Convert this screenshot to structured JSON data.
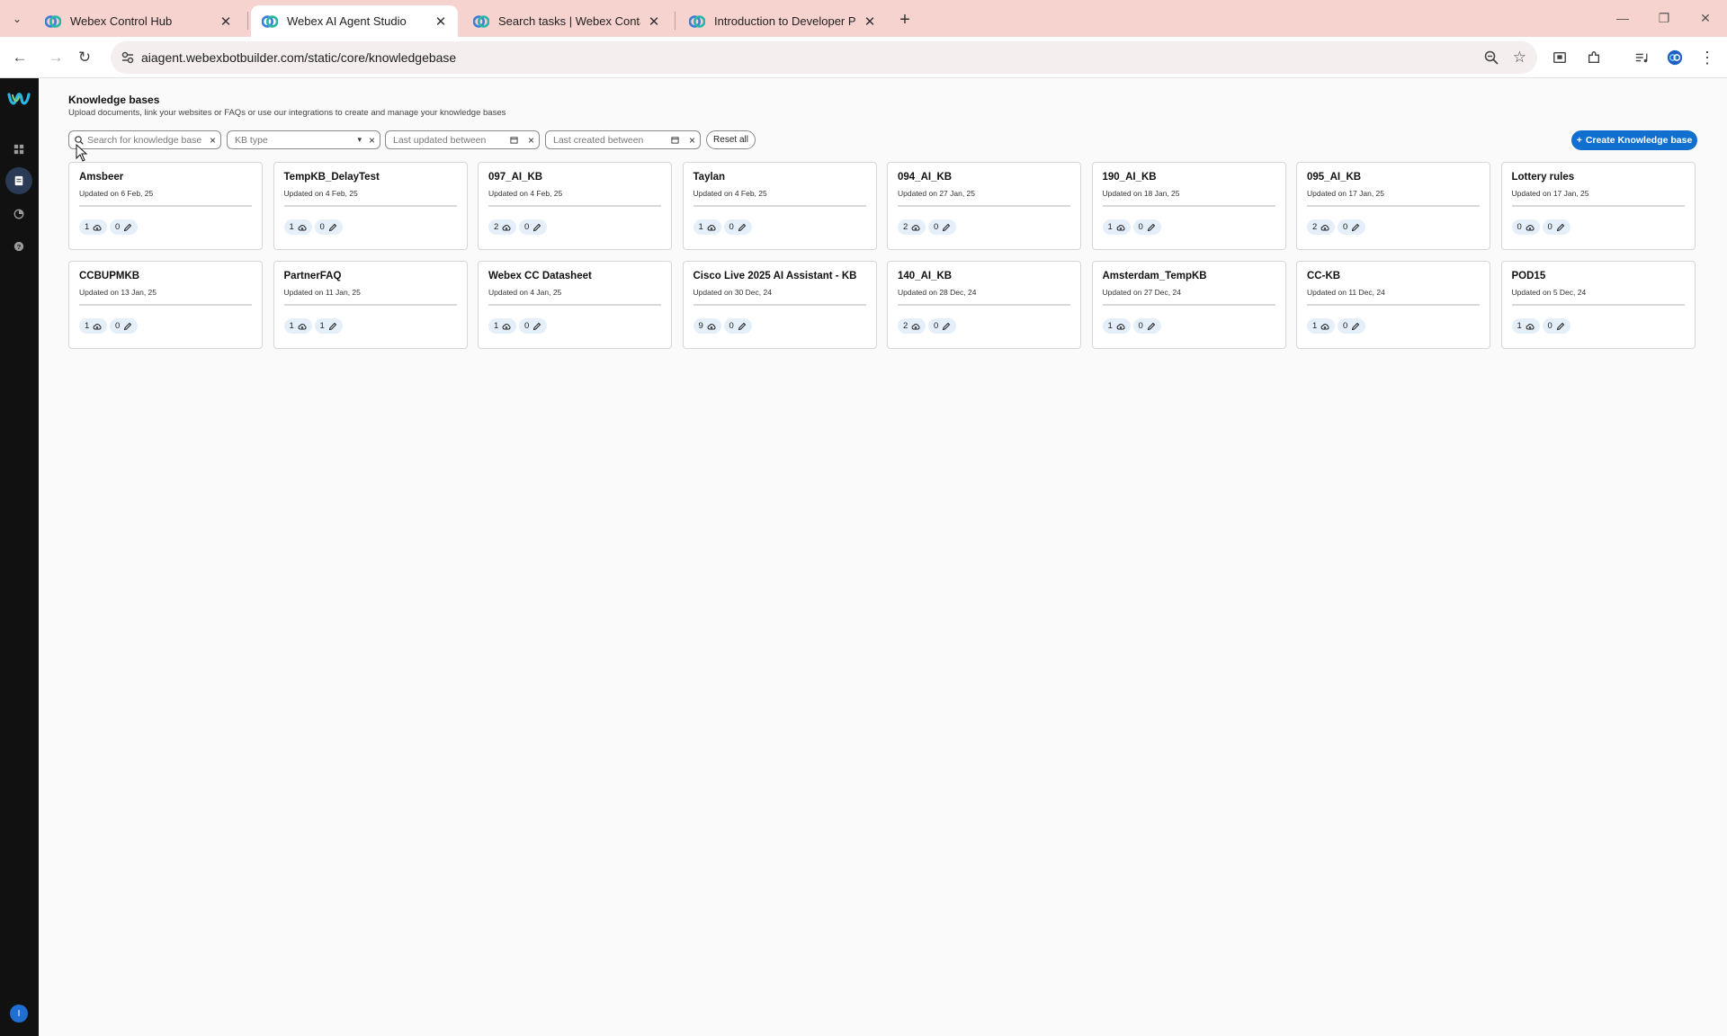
{
  "browser": {
    "tabs": [
      {
        "title": "Webex Control Hub",
        "active": false
      },
      {
        "title": "Webex AI Agent Studio",
        "active": true
      },
      {
        "title": "Search tasks | Webex Contact C",
        "active": false
      },
      {
        "title": "Introduction to Developer Porta",
        "active": false
      }
    ],
    "url": "aiagent.webexbotbuilder.com/static/core/knowledgebase"
  },
  "sidebar": {
    "items": [
      "dashboard-icon",
      "knowledge-base-icon",
      "analytics-icon",
      "help-icon"
    ],
    "active_item": "knowledge-base-icon",
    "avatar_initial": "I"
  },
  "page": {
    "title": "Knowledge bases",
    "subtitle": "Upload documents, link your websites or FAQs or use our integrations to create and manage your knowledge bases"
  },
  "filters": {
    "search_placeholder": "Search for knowledge base",
    "kb_type_placeholder": "KB type",
    "last_updated_placeholder": "Last updated between",
    "last_created_placeholder": "Last created between",
    "reset_label": "Reset all",
    "create_label": "Create Knowledge base",
    "create_prefix": "+"
  },
  "cards": [
    {
      "name": "Amsbeer",
      "updated": "Updated on 6 Feb, 25",
      "files": "1",
      "edits": "0"
    },
    {
      "name": "TempKB_DelayTest",
      "updated": "Updated on 4 Feb, 25",
      "files": "1",
      "edits": "0"
    },
    {
      "name": "097_AI_KB",
      "updated": "Updated on 4 Feb, 25",
      "files": "2",
      "edits": "0"
    },
    {
      "name": "Taylan",
      "updated": "Updated on 4 Feb, 25",
      "files": "1",
      "edits": "0"
    },
    {
      "name": "094_AI_KB",
      "updated": "Updated on 27 Jan, 25",
      "files": "2",
      "edits": "0"
    },
    {
      "name": "190_AI_KB",
      "updated": "Updated on 18 Jan, 25",
      "files": "1",
      "edits": "0"
    },
    {
      "name": "095_AI_KB",
      "updated": "Updated on 17 Jan, 25",
      "files": "2",
      "edits": "0"
    },
    {
      "name": "Lottery rules",
      "updated": "Updated on 17 Jan, 25",
      "files": "0",
      "edits": "0"
    },
    {
      "name": "CCBUPMKB",
      "updated": "Updated on 13 Jan, 25",
      "files": "1",
      "edits": "0"
    },
    {
      "name": "PartnerFAQ",
      "updated": "Updated on 11 Jan, 25",
      "files": "1",
      "edits": "1"
    },
    {
      "name": "Webex CC Datasheet",
      "updated": "Updated on 4 Jan, 25",
      "files": "1",
      "edits": "0"
    },
    {
      "name": "Cisco Live 2025 AI Assistant - KB",
      "updated": "Updated on 30 Dec, 24",
      "files": "9",
      "edits": "0"
    },
    {
      "name": "140_AI_KB",
      "updated": "Updated on 28 Dec, 24",
      "files": "2",
      "edits": "0"
    },
    {
      "name": "Amsterdam_TempKB",
      "updated": "Updated on 27 Dec, 24",
      "files": "1",
      "edits": "0"
    },
    {
      "name": "CC-KB",
      "updated": "Updated on 11 Dec, 24",
      "files": "1",
      "edits": "0"
    },
    {
      "name": "POD15",
      "updated": "Updated on 5 Dec, 24",
      "files": "1",
      "edits": "0"
    }
  ],
  "colors": {
    "accent": "#1170cf",
    "tabstrip": "#f7d3d0",
    "sidebar": "#111111",
    "pill": "#e4eff9"
  }
}
